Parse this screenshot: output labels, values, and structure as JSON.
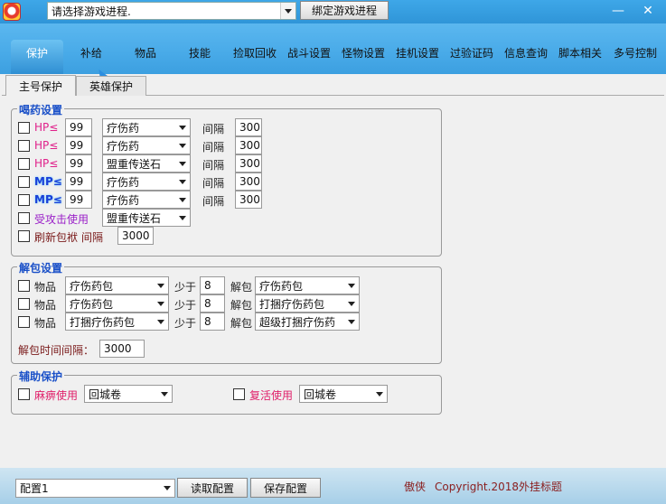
{
  "header": {
    "process_select": "请选择游戏进程.",
    "bind_button": "绑定游戏进程"
  },
  "window_controls": {
    "minimize": "—",
    "close": "✕"
  },
  "toolbar": {
    "items": [
      "保护",
      "补给",
      "物品",
      "技能",
      "捡取回收",
      "战斗设置",
      "怪物设置",
      "挂机设置",
      "过验证码",
      "信息查询",
      "脚本相关",
      "多号控制"
    ]
  },
  "subtabs": [
    "主号保护",
    "英雄保护"
  ],
  "potion": {
    "title": "喝药设置",
    "rows": [
      {
        "label": "HP≤",
        "value": "99",
        "item": "疗伤药",
        "interval_label": "间隔",
        "interval": "300"
      },
      {
        "label": "HP≤",
        "value": "99",
        "item": "疗伤药",
        "interval_label": "间隔",
        "interval": "300"
      },
      {
        "label": "HP≤",
        "value": "99",
        "item": "盟重传送石",
        "interval_label": "间隔",
        "interval": "300"
      },
      {
        "label": "MP≤",
        "value": "99",
        "item": "疗伤药",
        "interval_label": "间隔",
        "interval": "300"
      },
      {
        "label": "MP≤",
        "value": "99",
        "item": "疗伤药",
        "interval_label": "间隔",
        "interval": "300"
      }
    ],
    "attacked_label": "受攻击使用",
    "attacked_item": "盟重传送石",
    "refresh_label": "刷新包袱",
    "refresh_interval_label": "间隔",
    "refresh_interval": "3000"
  },
  "unpack": {
    "title": "解包设置",
    "rows": [
      {
        "label": "物品",
        "item": "疗伤药包",
        "less_label": "少于",
        "count": "8",
        "unpack_label": "解包",
        "target": "疗伤药包"
      },
      {
        "label": "物品",
        "item": "疗伤药包",
        "less_label": "少于",
        "count": "8",
        "unpack_label": "解包",
        "target": "打捆疗伤药包"
      },
      {
        "label": "物品",
        "item": "打捆疗伤药包",
        "less_label": "少于",
        "count": "8",
        "unpack_label": "解包",
        "target": "超级打捆疗伤药"
      }
    ],
    "interval_label": "解包时间间隔：",
    "interval": "3000"
  },
  "assist": {
    "title": "辅助保护",
    "paralysis_label": "麻痹使用",
    "paralysis_item": "回城卷",
    "revive_label": "复活使用",
    "revive_item": "回城卷"
  },
  "footer": {
    "config_select": "配置1",
    "read_button": "读取配置",
    "save_button": "保存配置",
    "author": "傲侠",
    "copyright": "Copyright.2018外挂标题"
  }
}
